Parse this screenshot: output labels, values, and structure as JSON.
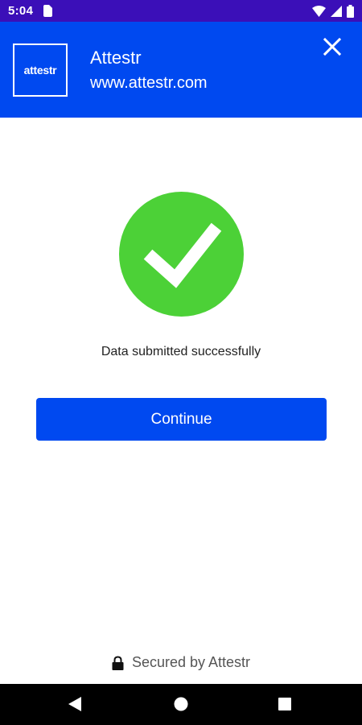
{
  "status_bar": {
    "time": "5:04",
    "icons": [
      "sim-card-icon",
      "wifi-icon",
      "signal-icon",
      "battery-icon"
    ]
  },
  "header": {
    "logo_text": "attestr",
    "app_name": "Attestr",
    "app_url": "www.attestr.com",
    "close_icon": "close-icon"
  },
  "main": {
    "status_icon": "checkmark-icon",
    "message": "Data submitted successfully",
    "continue_label": "Continue"
  },
  "footer": {
    "lock_icon": "lock-icon",
    "secured_text": "Secured by Attestr"
  },
  "nav_bar": {
    "icons": [
      "back-icon",
      "home-icon",
      "recents-icon"
    ]
  },
  "colors": {
    "status_bar": "#3b0fb8",
    "brand": "#0049f0",
    "success": "#4cd137"
  }
}
